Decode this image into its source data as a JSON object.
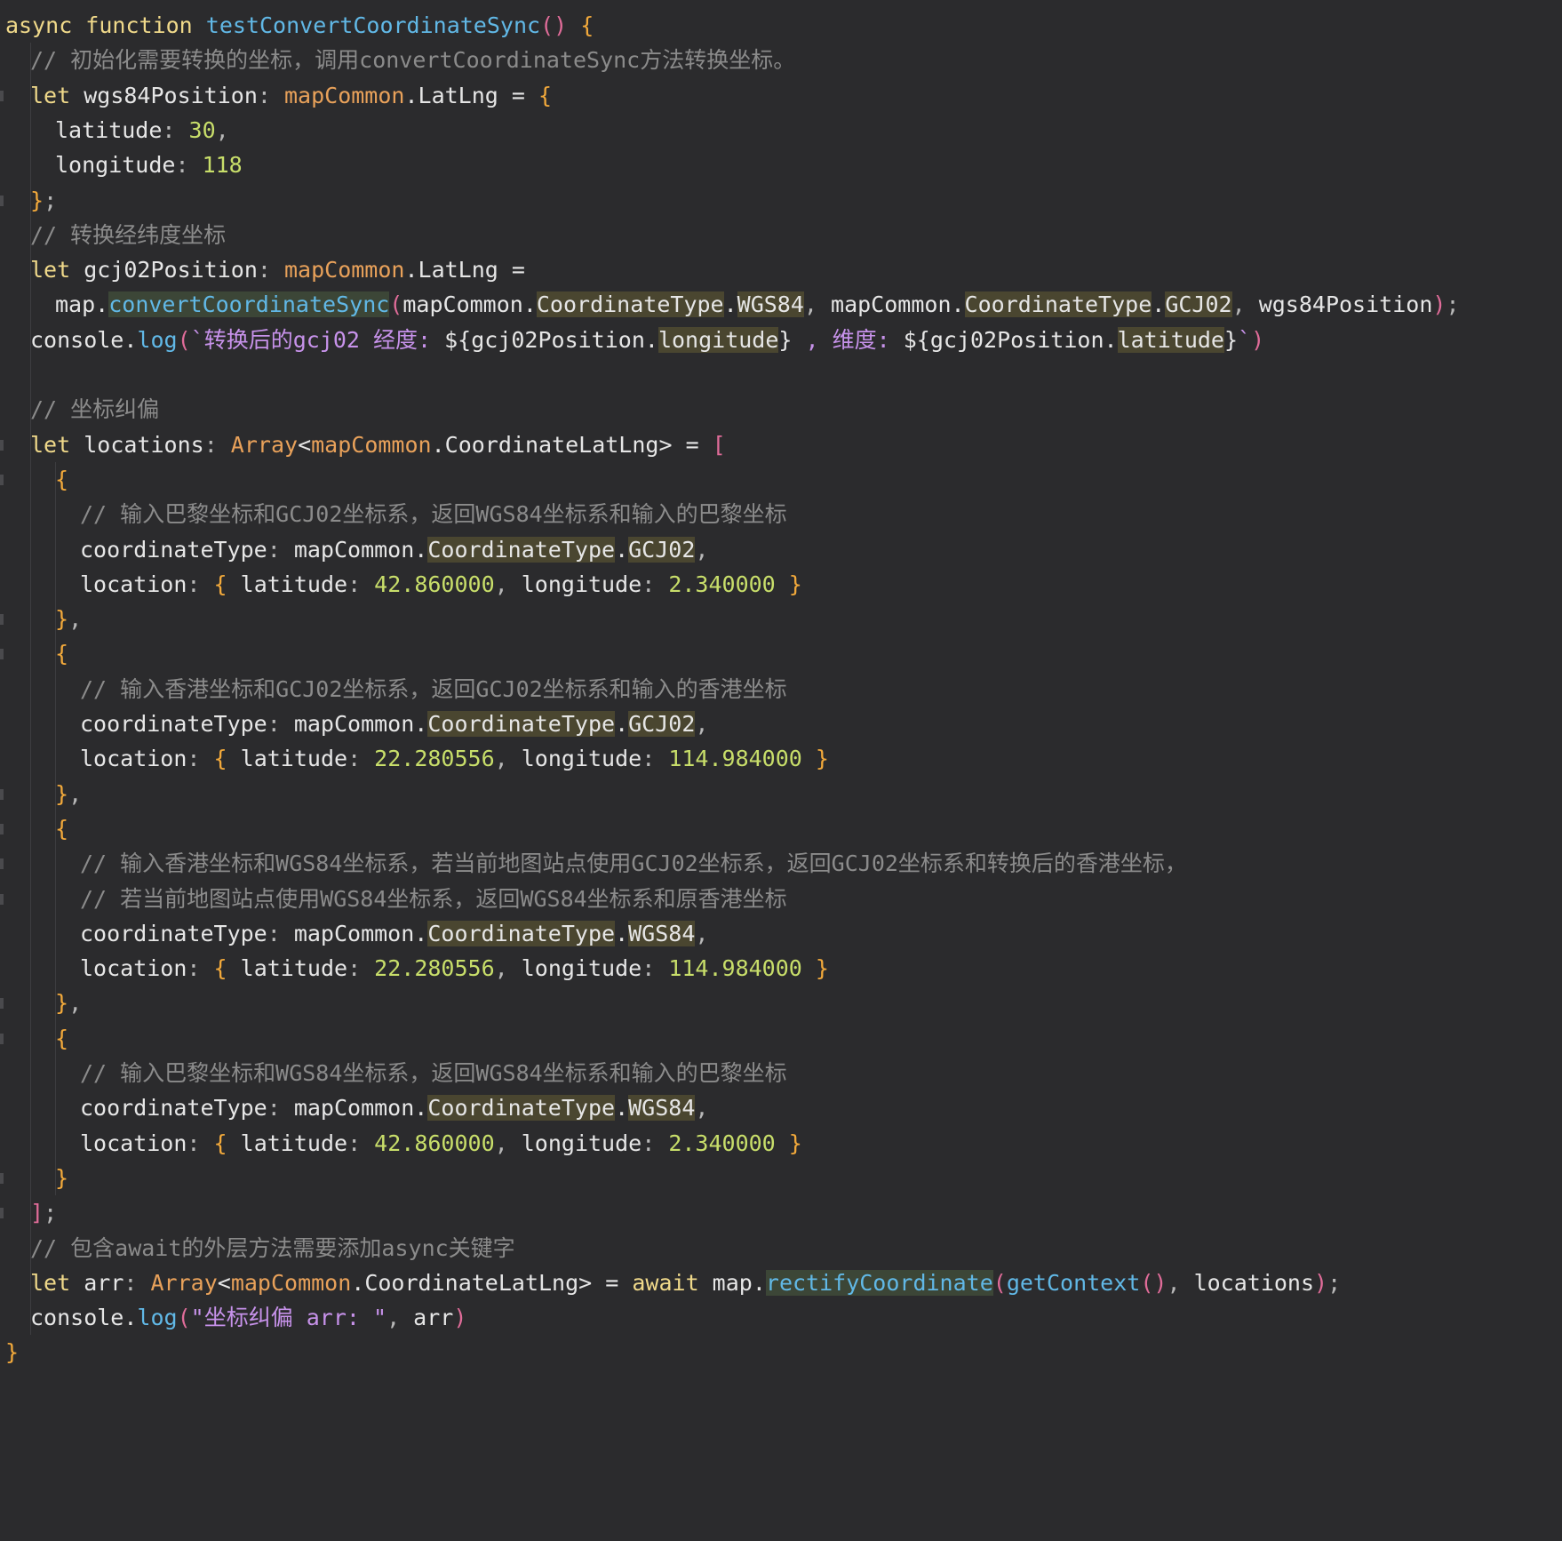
{
  "editor": {
    "language": "ArkTS",
    "lines": [
      {
        "indent": 0,
        "fold": false,
        "tokens": [
          [
            "kw",
            "async function "
          ],
          [
            "fn",
            "testConvertCoordinateSync"
          ],
          [
            "brk2",
            "() "
          ],
          [
            "brk",
            "{"
          ]
        ]
      },
      {
        "indent": 1,
        "fold": false,
        "tokens": [
          [
            "cmt",
            "// 初始化需要转换的坐标，调用convertCoordinateSync方法转换坐标。"
          ]
        ]
      },
      {
        "indent": 1,
        "fold": true,
        "tokens": [
          [
            "kw",
            "let "
          ],
          [
            "pl",
            "wgs84Position"
          ],
          [
            "punc",
            ": "
          ],
          [
            "ty",
            "mapCommon"
          ],
          [
            "pl",
            ".LatLng = "
          ],
          [
            "brk",
            "{"
          ]
        ]
      },
      {
        "indent": 2,
        "fold": false,
        "tokens": [
          [
            "pl",
            "latitude"
          ],
          [
            "punc",
            ": "
          ],
          [
            "num",
            "30"
          ],
          [
            "punc",
            ","
          ]
        ]
      },
      {
        "indent": 2,
        "fold": false,
        "tokens": [
          [
            "pl",
            "longitude"
          ],
          [
            "punc",
            ": "
          ],
          [
            "num",
            "118"
          ]
        ]
      },
      {
        "indent": 1,
        "fold": true,
        "tokens": [
          [
            "brk",
            "}"
          ],
          [
            "punc",
            ";"
          ]
        ]
      },
      {
        "indent": 1,
        "fold": false,
        "tokens": [
          [
            "cmt",
            "// 转换经纬度坐标"
          ]
        ]
      },
      {
        "indent": 1,
        "fold": false,
        "tokens": [
          [
            "kw",
            "let "
          ],
          [
            "pl",
            "gcj02Position"
          ],
          [
            "punc",
            ": "
          ],
          [
            "ty",
            "mapCommon"
          ],
          [
            "pl",
            ".LatLng ="
          ]
        ]
      },
      {
        "indent": 2,
        "fold": false,
        "tokens": [
          [
            "pl",
            "map."
          ],
          [
            "fn hlb",
            "convertCoordinateSync"
          ],
          [
            "brk2",
            "("
          ],
          [
            "pl",
            "mapCommon."
          ],
          [
            "pl hl",
            "CoordinateType"
          ],
          [
            "pl",
            "."
          ],
          [
            "pl hl",
            "WGS84"
          ],
          [
            "punc",
            ", "
          ],
          [
            "pl",
            "mapCommon."
          ],
          [
            "pl hl",
            "CoordinateType"
          ],
          [
            "pl",
            "."
          ],
          [
            "pl hl",
            "GCJ02"
          ],
          [
            "punc",
            ", "
          ],
          [
            "pl",
            "wgs84Position"
          ],
          [
            "brk2",
            ")"
          ],
          [
            "punc",
            ";"
          ]
        ]
      },
      {
        "indent": 1,
        "fold": false,
        "tokens": [
          [
            "pl",
            "console."
          ],
          [
            "fn",
            "log"
          ],
          [
            "brk2",
            "("
          ],
          [
            "str",
            "`转换后的gcj02 经度: "
          ],
          [
            "pl",
            "${gcj02Position."
          ],
          [
            "pl hl",
            "longitude"
          ],
          [
            "pl",
            "}"
          ],
          [
            "str",
            " , 维度: "
          ],
          [
            "pl",
            "${gcj02Position."
          ],
          [
            "pl hl",
            "latitude"
          ],
          [
            "pl",
            "}"
          ],
          [
            "str",
            "`"
          ],
          [
            "brk2",
            ")"
          ]
        ]
      },
      {
        "indent": 0,
        "fold": false,
        "tokens": []
      },
      {
        "indent": 1,
        "fold": false,
        "tokens": [
          [
            "cmt",
            "// 坐标纠偏"
          ]
        ]
      },
      {
        "indent": 1,
        "fold": true,
        "tokens": [
          [
            "kw",
            "let "
          ],
          [
            "pl",
            "locations"
          ],
          [
            "punc",
            ": "
          ],
          [
            "ty",
            "Array"
          ],
          [
            "pl",
            "<"
          ],
          [
            "ty",
            "mapCommon"
          ],
          [
            "pl",
            ".CoordinateLatLng> = "
          ],
          [
            "brk2",
            "["
          ]
        ]
      },
      {
        "indent": 2,
        "fold": true,
        "tokens": [
          [
            "brk",
            "{"
          ]
        ]
      },
      {
        "indent": 3,
        "fold": false,
        "tokens": [
          [
            "cmt",
            "// 输入巴黎坐标和GCJ02坐标系，返回WGS84坐标系和输入的巴黎坐标"
          ]
        ]
      },
      {
        "indent": 3,
        "fold": false,
        "tokens": [
          [
            "pl",
            "coordinateType"
          ],
          [
            "punc",
            ": "
          ],
          [
            "pl",
            "mapCommon."
          ],
          [
            "pl hl",
            "CoordinateType"
          ],
          [
            "pl",
            "."
          ],
          [
            "pl hl",
            "GCJ02"
          ],
          [
            "punc",
            ","
          ]
        ]
      },
      {
        "indent": 3,
        "fold": false,
        "tokens": [
          [
            "pl",
            "location"
          ],
          [
            "punc",
            ": "
          ],
          [
            "brk",
            "{ "
          ],
          [
            "pl",
            "latitude"
          ],
          [
            "punc",
            ": "
          ],
          [
            "num",
            "42.860000"
          ],
          [
            "punc",
            ", "
          ],
          [
            "pl",
            "longitude"
          ],
          [
            "punc",
            ": "
          ],
          [
            "num",
            "2.340000"
          ],
          [
            "brk",
            " }"
          ]
        ]
      },
      {
        "indent": 2,
        "fold": true,
        "tokens": [
          [
            "brk",
            "}"
          ],
          [
            "punc",
            ","
          ]
        ]
      },
      {
        "indent": 2,
        "fold": true,
        "tokens": [
          [
            "brk",
            "{"
          ]
        ]
      },
      {
        "indent": 3,
        "fold": false,
        "tokens": [
          [
            "cmt",
            "// 输入香港坐标和GCJ02坐标系，返回GCJ02坐标系和输入的香港坐标"
          ]
        ]
      },
      {
        "indent": 3,
        "fold": false,
        "tokens": [
          [
            "pl",
            "coordinateType"
          ],
          [
            "punc",
            ": "
          ],
          [
            "pl",
            "mapCommon."
          ],
          [
            "pl hl",
            "CoordinateType"
          ],
          [
            "pl",
            "."
          ],
          [
            "pl hl",
            "GCJ02"
          ],
          [
            "punc",
            ","
          ]
        ]
      },
      {
        "indent": 3,
        "fold": false,
        "tokens": [
          [
            "pl",
            "location"
          ],
          [
            "punc",
            ": "
          ],
          [
            "brk",
            "{ "
          ],
          [
            "pl",
            "latitude"
          ],
          [
            "punc",
            ": "
          ],
          [
            "num",
            "22.280556"
          ],
          [
            "punc",
            ", "
          ],
          [
            "pl",
            "longitude"
          ],
          [
            "punc",
            ": "
          ],
          [
            "num",
            "114.984000"
          ],
          [
            "brk",
            " }"
          ]
        ]
      },
      {
        "indent": 2,
        "fold": true,
        "tokens": [
          [
            "brk",
            "}"
          ],
          [
            "punc",
            ","
          ]
        ]
      },
      {
        "indent": 2,
        "fold": true,
        "tokens": [
          [
            "brk",
            "{"
          ]
        ]
      },
      {
        "indent": 3,
        "fold": true,
        "tokens": [
          [
            "cmt",
            "// 输入香港坐标和WGS84坐标系，若当前地图站点使用GCJ02坐标系，返回GCJ02坐标系和转换后的香港坐标，"
          ]
        ]
      },
      {
        "indent": 3,
        "fold": true,
        "tokens": [
          [
            "cmt",
            "// 若当前地图站点使用WGS84坐标系，返回WGS84坐标系和原香港坐标"
          ]
        ]
      },
      {
        "indent": 3,
        "fold": false,
        "tokens": [
          [
            "pl",
            "coordinateType"
          ],
          [
            "punc",
            ": "
          ],
          [
            "pl",
            "mapCommon."
          ],
          [
            "pl hl",
            "CoordinateType"
          ],
          [
            "pl",
            "."
          ],
          [
            "pl hl",
            "WGS84"
          ],
          [
            "punc",
            ","
          ]
        ]
      },
      {
        "indent": 3,
        "fold": false,
        "tokens": [
          [
            "pl",
            "location"
          ],
          [
            "punc",
            ": "
          ],
          [
            "brk",
            "{ "
          ],
          [
            "pl",
            "latitude"
          ],
          [
            "punc",
            ": "
          ],
          [
            "num",
            "22.280556"
          ],
          [
            "punc",
            ", "
          ],
          [
            "pl",
            "longitude"
          ],
          [
            "punc",
            ": "
          ],
          [
            "num",
            "114.984000"
          ],
          [
            "brk",
            " }"
          ]
        ]
      },
      {
        "indent": 2,
        "fold": true,
        "tokens": [
          [
            "brk",
            "}"
          ],
          [
            "punc",
            ","
          ]
        ]
      },
      {
        "indent": 2,
        "fold": true,
        "tokens": [
          [
            "brk",
            "{"
          ]
        ]
      },
      {
        "indent": 3,
        "fold": false,
        "tokens": [
          [
            "cmt",
            "// 输入巴黎坐标和WGS84坐标系，返回WGS84坐标系和输入的巴黎坐标"
          ]
        ]
      },
      {
        "indent": 3,
        "fold": false,
        "tokens": [
          [
            "pl",
            "coordinateType"
          ],
          [
            "punc",
            ": "
          ],
          [
            "pl",
            "mapCommon."
          ],
          [
            "pl hl",
            "CoordinateType"
          ],
          [
            "pl",
            "."
          ],
          [
            "pl hl",
            "WGS84"
          ],
          [
            "punc",
            ","
          ]
        ]
      },
      {
        "indent": 3,
        "fold": false,
        "tokens": [
          [
            "pl",
            "location"
          ],
          [
            "punc",
            ": "
          ],
          [
            "brk",
            "{ "
          ],
          [
            "pl",
            "latitude"
          ],
          [
            "punc",
            ": "
          ],
          [
            "num",
            "42.860000"
          ],
          [
            "punc",
            ", "
          ],
          [
            "pl",
            "longitude"
          ],
          [
            "punc",
            ": "
          ],
          [
            "num",
            "2.340000"
          ],
          [
            "brk",
            " }"
          ]
        ]
      },
      {
        "indent": 2,
        "fold": true,
        "tokens": [
          [
            "brk",
            "}"
          ]
        ]
      },
      {
        "indent": 1,
        "fold": true,
        "tokens": [
          [
            "brk2",
            "]"
          ],
          [
            "punc",
            ";"
          ]
        ]
      },
      {
        "indent": 1,
        "fold": false,
        "tokens": [
          [
            "cmt",
            "// 包含await的外层方法需要添加async关键字"
          ]
        ]
      },
      {
        "indent": 1,
        "fold": false,
        "tokens": [
          [
            "kw",
            "let "
          ],
          [
            "pl",
            "arr"
          ],
          [
            "punc",
            ": "
          ],
          [
            "ty",
            "Array"
          ],
          [
            "pl",
            "<"
          ],
          [
            "ty",
            "mapCommon"
          ],
          [
            "pl",
            ".CoordinateLatLng> = "
          ],
          [
            "kw",
            "await "
          ],
          [
            "pl",
            "map."
          ],
          [
            "fn hlb",
            "rectifyCoordinate"
          ],
          [
            "brk2",
            "("
          ],
          [
            "fn",
            "getContext"
          ],
          [
            "brk2",
            "()"
          ],
          [
            "punc",
            ", "
          ],
          [
            "pl",
            "locations"
          ],
          [
            "brk2",
            ")"
          ],
          [
            "punc",
            ";"
          ]
        ]
      },
      {
        "indent": 1,
        "fold": false,
        "tokens": [
          [
            "pl",
            "console."
          ],
          [
            "fn",
            "log"
          ],
          [
            "brk2",
            "("
          ],
          [
            "str",
            "\"坐标纠偏 arr: \""
          ],
          [
            "punc",
            ", "
          ],
          [
            "pl",
            "arr"
          ],
          [
            "brk2",
            ")"
          ]
        ]
      },
      {
        "indent": 0,
        "fold": false,
        "tokens": [
          [
            "brk",
            "}"
          ]
        ]
      }
    ]
  }
}
